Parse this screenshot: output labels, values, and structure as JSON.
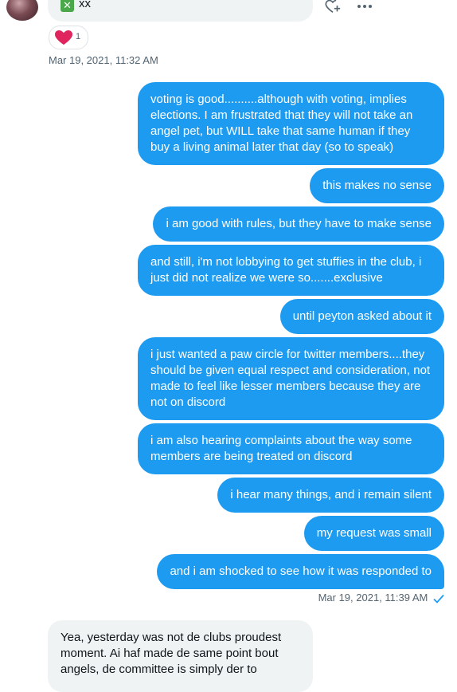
{
  "top_message": {
    "icon": "cross-mark-box",
    "text": "xx",
    "reaction": {
      "emoji": "heart",
      "count": "1"
    },
    "timestamp": "Mar 19, 2021, 11:32 AM"
  },
  "sent_messages": [
    "voting is good..........although with voting, implies elections. I am frustrated that they will not take an angel pet, but WILL take that same human if they buy a living animal later that day (so to speak)",
    "this makes no sense",
    "i am good with rules, but they have to make sense",
    "and still, i'm not lobbying to get stuffies in the club, i just did not realize we were so.......exclusive",
    "until peyton asked about it",
    "i just wanted a paw circle for twitter members....they should be given equal respect and consideration, not made to feel like lesser members because they are not on discord",
    "i am also hearing complaints about the way some members are being treated on discord",
    "i hear many things, and i remain silent",
    "my request was small",
    "and i am shocked to see how it was responded to"
  ],
  "sent_timestamp": "Mar 19, 2021, 11:39 AM",
  "received_bottom": "Yea, yesterday was not de clubs proudest moment. Ai haf made de same point bout angels, de committee is simply der to",
  "colors": {
    "sent_bubble": "#1d9bf0",
    "received_bubble": "#eff3f4",
    "timestamp": "#536471"
  }
}
